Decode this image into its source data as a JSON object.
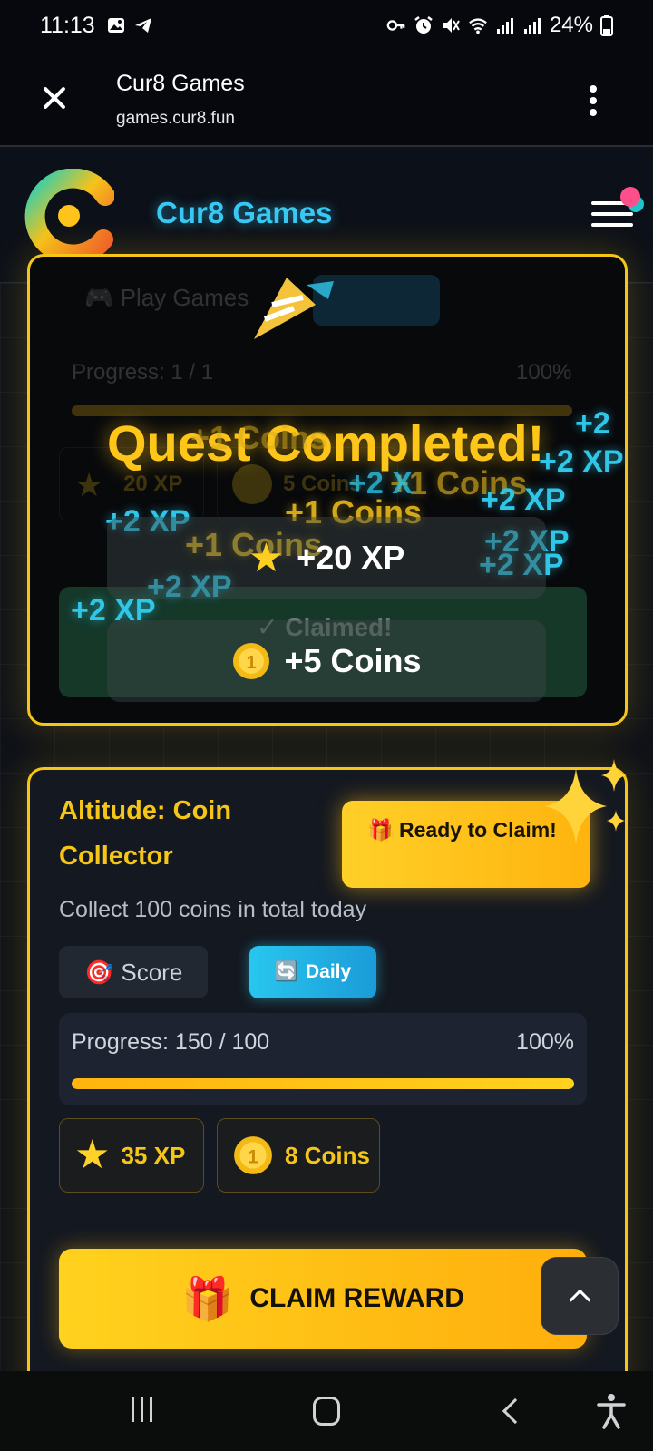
{
  "status_bar": {
    "time": "11:13",
    "battery": "24%"
  },
  "browser": {
    "title": "Cur8 Games",
    "url": "games.cur8.fun"
  },
  "site": {
    "title": "Cur8 Games"
  },
  "completed_quest": {
    "tag_play": "🎮 Play Games",
    "tag_daily": "🔄 Daily",
    "progress_label": "Progress: 1 / 1",
    "progress_pct": "100%",
    "reward_xp_chip": "20 XP",
    "reward_coins_chip": "5 Coins",
    "claimed_label": "✓ Claimed!",
    "overlay_title": "Quest Completed!",
    "overlay_xp": "+20 XP",
    "overlay_coins": "+5 Coins",
    "floating": {
      "xp": "+2 XP",
      "coins": "+1 Coins",
      "xp_partial": "+2",
      "xp_cut": "+2 X"
    }
  },
  "quest": {
    "title": "Altitude: Coin Collector",
    "badge": "Ready to Claim!",
    "badge_icon": "🎁",
    "description": "Collect 100 coins in total today",
    "tag_score_icon": "🎯",
    "tag_score": "Score",
    "tag_daily_icon": "🔄",
    "tag_daily": "Daily",
    "progress_label": "Progress: 150 / 100",
    "progress_pct": "100%",
    "progress_fraction": 1.0,
    "reward_xp": "35 XP",
    "reward_coins": "8 Coins",
    "claim_icon": "🎁",
    "claim_button": "CLAIM REWARD"
  },
  "colors": {
    "accent_gold": "#f5c518",
    "accent_cyan": "#38c8f4",
    "claimed_green": "#173e2c"
  }
}
